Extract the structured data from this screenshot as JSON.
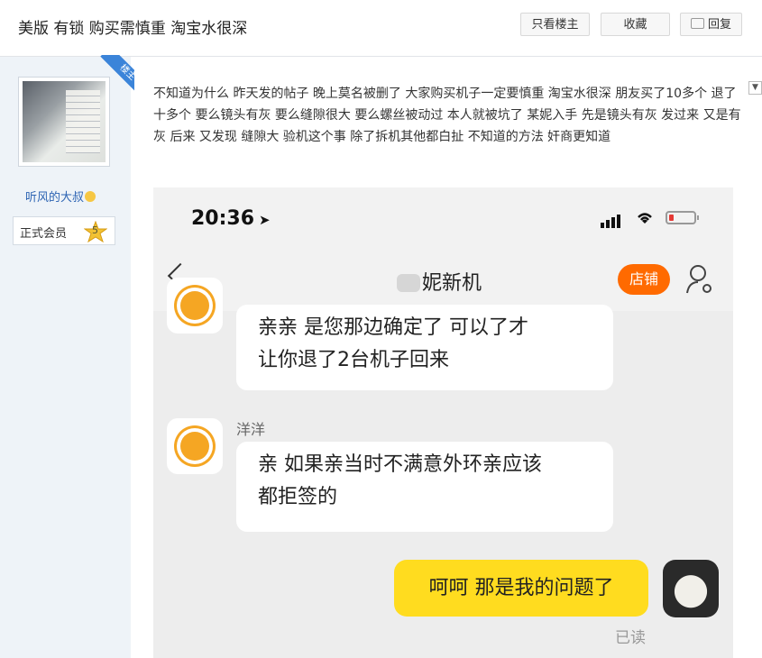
{
  "thread": {
    "title": "美版 有锁 购买需慎重 淘宝水很深",
    "buttons": {
      "only_op": "只看楼主",
      "favorite": "收藏",
      "reply": "回复"
    }
  },
  "author": {
    "badge": "楼主",
    "username": "听风的大叔",
    "member_label": "正式会员",
    "level": "5"
  },
  "post": {
    "text": "不知道为什么 昨天发的帖子 晚上莫名被删了 大家购买机子一定要慎重 淘宝水很深 朋友买了10多个 退了十多个 要么镜头有灰 要么缝隙很大 要么螺丝被动过 本人就被坑了 某妮入手 先是镜头有灰 发过来 又是有灰 后来 又发现 缝隙大 验机这个事 除了拆机其他都白扯 不知道的方法 奸商更知道"
  },
  "screenshot": {
    "time": "20:36",
    "shop_name": "妮新机",
    "shop_button": "店铺",
    "messages": [
      {
        "text_line1": "亲亲  是您那边确定了 可以了才",
        "text_line2": "让你退了2台机子回来"
      },
      {
        "sender": "洋洋",
        "text_line1": "亲  如果亲当时不满意外环亲应该",
        "text_line2": "都拒签的"
      },
      {
        "text": "呵呵 那是我的问题了",
        "status": "已读"
      }
    ]
  }
}
